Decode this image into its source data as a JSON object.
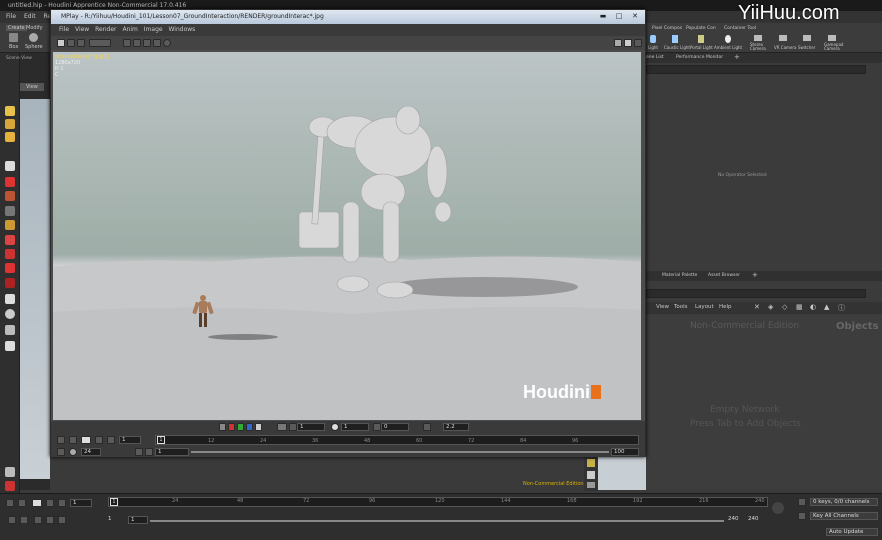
{
  "app": {
    "title": "untitled.hip - Houdini Apprentice Non-Commercial 17.0.416",
    "menus": [
      "File",
      "Edit",
      "Render"
    ]
  },
  "shelf": {
    "tabs": [
      "Create",
      "Modify"
    ],
    "tools": [
      "Box",
      "Sphere"
    ],
    "right_tabs": [
      "Pixel Compos",
      "Populate Con",
      "Container Tool"
    ],
    "right_tools": [
      "Light",
      "Caustic Light",
      "Portal Light",
      "Ambient Light",
      "Stereo Camera",
      "VR Camera",
      "Switcher",
      "Gamepad Camera"
    ]
  },
  "scene_view": {
    "label": "Scene View",
    "view_tab": "View"
  },
  "mplay": {
    "title": "MPlay - R:/Yiihuu/Houdini_101/Lesson07_GroundInteraction/RENDER/groundInterac*.jpg",
    "menus": [
      "File",
      "View",
      "Render",
      "Anim",
      "Image",
      "Windows"
    ],
    "overlay_lines": [
      "groundInterac*.jpg[1]",
      "1280x720",
      "fr 1",
      "C"
    ],
    "watermark": "Houdini",
    "frame_field": "1",
    "range_start": "1",
    "range_end": "100",
    "fps": "24",
    "tick_labels": [
      "1",
      "12",
      "24",
      "36",
      "48",
      "60",
      "72",
      "84",
      "96"
    ],
    "tb_values": [
      "1",
      "1",
      "0",
      "2.2"
    ]
  },
  "right_panel": {
    "top_tabs": [
      "ene List",
      "Performance Monitor"
    ],
    "no_operator": "No Operator Selected",
    "mid_tabs": [
      "Material Palette",
      "Asset Browser"
    ],
    "net_menus": [
      "View",
      "Tools",
      "Layout",
      "Help"
    ],
    "network_banner": "Non-Commercial Edition",
    "objects_label": "Objects",
    "empty_title": "Empty Network",
    "empty_hint": "Press Tab to Add Objects"
  },
  "viewport_main": {
    "nc_label": "Non-Commercial Edition"
  },
  "playbar": {
    "frame": "1",
    "tick_labels": [
      "1",
      "24",
      "48",
      "72",
      "96",
      "120",
      "144",
      "168",
      "192",
      "216",
      "240"
    ],
    "range_start": "1",
    "range_start2": "1",
    "range_end": "240",
    "range_end2": "240",
    "keys_label": "0 keys, 0/0 channels",
    "channels_label": "Key All Channels",
    "auto_update": "Auto Update"
  },
  "watermark_site": "YiiHuu.com"
}
